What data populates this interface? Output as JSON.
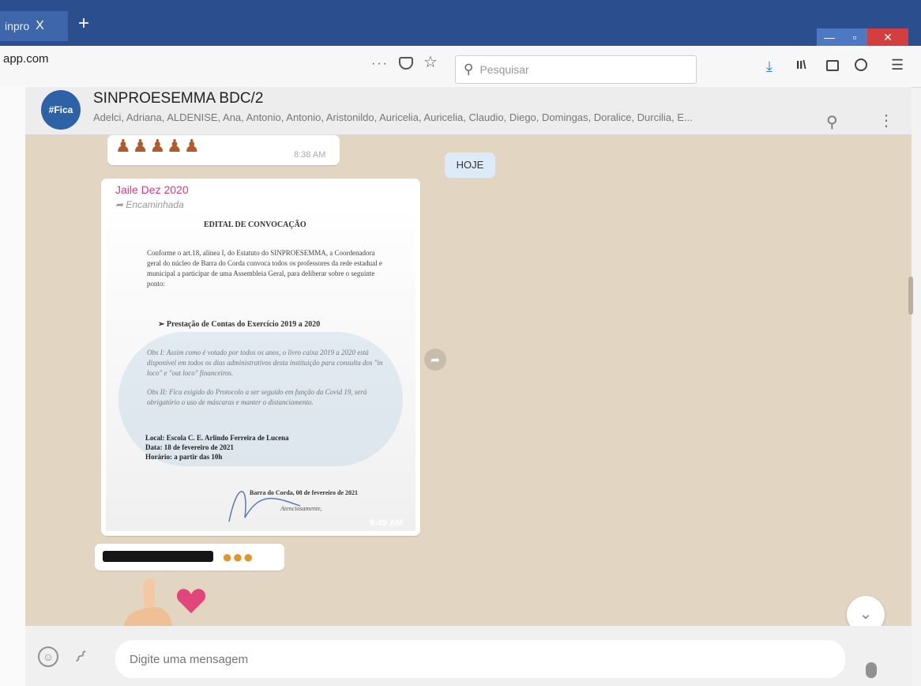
{
  "browser": {
    "tab_title": "inpro",
    "tab_close": "X",
    "new_tab": "+",
    "url": "app.com",
    "page_actions": "···",
    "search_placeholder": "Pesquisar"
  },
  "window_controls": {
    "min": "—",
    "max": "▫",
    "close": "✕"
  },
  "chat_header": {
    "avatar_text": "#Fica",
    "group_name": "SINPROESEMMA BDC/2",
    "members": "Adelci, Adriana, ALDENISE, Ana, Antonio, Antonio, Aristonildo, Auricelia, Auricelia, Claudio, Diego, Domingas, Doralice, Durcilia, E..."
  },
  "messages": {
    "first_time": "8:38 AM",
    "date_badge": "HOJE",
    "sender": "Jaile Dez 2020",
    "forwarded": "Encaminhada",
    "doc_time": "8:49 AM"
  },
  "document": {
    "title": "EDITAL DE CONVOCAÇÃO",
    "para1": "Conforme o art.18, alínea I, do Estatuto do SINPROESEMMA, a Coordenadora geral do núcleo de Barra do Corda convoca todos os professores da rede estadual e municipal a participar de uma Assembleia Geral, para deliberar sobre o seguinte ponto:",
    "item": "➢ Prestação de Contas do Exercício 2019 a 2020",
    "obs1": "Obs I: Assim como é votado por todos os anos, o livro caixa 2019 a 2020 está disponível em todos os dias administrativos desta instituição para consulta dos \"in loco\" e \"out loco\" financeiros.",
    "obs2": "Obs II: Fica exigido do Protocolo a ser seguido em função da Covid 19, será obrigatório o uso de máscaras e manter o distanciamento.",
    "local": "Local: Escola C. E. Arlindo Ferreira de Lucena",
    "date": "Data: 18 de fevereiro de 2021",
    "time": "Horário: a partir das 10h",
    "sign1": "Barra do Corda, 08 de fevereiro de 2021",
    "sign2": "Atenciosamente,"
  },
  "footer": {
    "placeholder": "Digite uma mensagem"
  },
  "icons": {
    "emoji_button": "☺",
    "forward_arrow": "➦",
    "scroll_down": "⌄",
    "search": "🔍",
    "menu": "⋮"
  },
  "colors": {
    "tab_bar": "#2b4f8e",
    "chat_bg": "#e2d5c2",
    "sender_name": "#d63b84",
    "date_badge": "#dcebf7"
  }
}
